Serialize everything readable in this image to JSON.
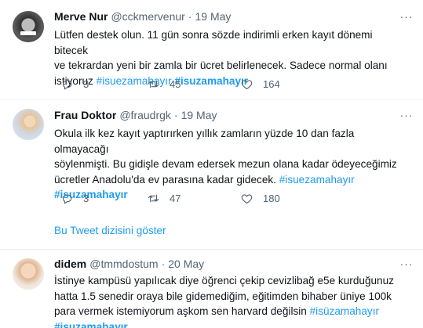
{
  "tweets": [
    {
      "name": "Merve Nur",
      "handle": "@cckmervenur",
      "separator": "·",
      "time": "19 May",
      "lines": [
        "Lütfen destek olun. 11 gün sonra sözde indirimli erken kayıt dönemi bitecek",
        "ve tekrardan yeni bir zamla bir ücret belirlenecek. Sadece normal olanı",
        "istiyoruz "
      ],
      "hashtag": "#isuezamahayır",
      "hashtag_bold": "#isuzamahayır",
      "replies": "3",
      "retweets": "45",
      "likes": "164"
    },
    {
      "name": "Frau Doktor",
      "handle": "@fraudrgk",
      "separator": "·",
      "time": "19 May",
      "lines": [
        "Okula ilk kez kayıt yaptırırken yıllık zamların yüzde 10 dan fazla olmayacağı",
        "söylenmişti. Bu gidişle devam edersek mezun olana kadar ödeyeceğimiz",
        "ücretler Anadolu'da ev parasına kadar gidecek. "
      ],
      "hashtag": "#isuezamahayır",
      "hashtag_bold": "#isuzamahayır",
      "replies": "3",
      "retweets": "47",
      "likes": "180"
    },
    {
      "name": "didem",
      "handle": "@tmmdostum",
      "separator": "·",
      "time": "20 May",
      "lines": [
        "İstinye kampüsü yapılıcak diye öğrenci çekip cevizlibağ e5e kurduğunuz",
        "hatta 1.5 senedir oraya bile gidemediğim, eğitimden bihaber üniye 100k",
        "para vermek istemiyorum aşkom sen harvard değilsin "
      ],
      "hashtag": "#isüzamahayır",
      "hashtag_bold": "#isuzamahayır"
    }
  ],
  "show_more_label": "Bu Tweet dizisini göster",
  "more_glyph": "···",
  "icons": [
    "more-icon",
    "reply-icon",
    "retweet-icon",
    "like-icon"
  ],
  "colors": {
    "link": "#1d9bf0",
    "secondary": "#536471",
    "divider": "#eff3f4"
  }
}
